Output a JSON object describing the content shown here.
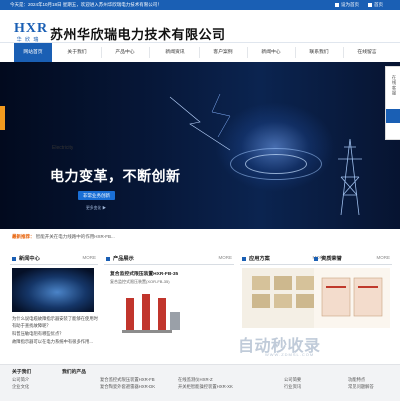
{
  "topbar": {
    "today": "今天是：2024年10月18日 星期五，欢迎进入苏州华欣瑞电力技术有限公司！",
    "favorite": "设为首页",
    "home": "首页"
  },
  "header": {
    "logo_mark": "HXR",
    "logo_cn": "华 欣 瑞",
    "company_cn": "苏州华欣瑞电力技术有限公司",
    "company_en": "Suzhou Huaxinrui Power Technology Co., Ltd."
  },
  "nav": {
    "items": [
      "网站首页",
      "关于我们",
      "产品中心",
      "新闻资讯",
      "客户案例",
      "新闻中心",
      "联系我们",
      "在线留言"
    ]
  },
  "banner": {
    "title_en": "Electricity",
    "title_cn": "电力变革，不断创新",
    "button": "非常业务创新",
    "sub": "更多变化 ▶"
  },
  "rightbar": {
    "label": "在线客服"
  },
  "notice": {
    "label": "最新推荐：",
    "text": "智能开关在电力线路中的作用HXR-FB..."
  },
  "sections": {
    "news": {
      "title": "新闻中心",
      "more": "MORE",
      "items": [
        "为什么说电缆故障指示器安装了能够在使用时有助于查找故障呢？",
        "科普压敏电阻有哪些优点？",
        "故障指示器可以在电力系统中有很多作用..."
      ]
    },
    "products": {
      "title": "产品展示",
      "more": "MORE",
      "name": "复合监控式限压装置HXR-FB-35",
      "desc": "复合监控式限压装置(XOR-FB-35)"
    },
    "cases": {
      "title": "应用方案",
      "more": "MORE"
    },
    "honors": {
      "title": "资质荣誉",
      "more": "MORE"
    }
  },
  "footer": {
    "about": {
      "title": "关于我们",
      "items": [
        "公司简介",
        "企业文化"
      ]
    },
    "products": {
      "title": "我们的产品",
      "items": [
        "复合监控式限压装置HXR-FB",
        "复合陶瓷外套避雷器HXR-DK"
      ]
    },
    "col3": {
      "items": [
        "在线监测仪HXR-Z",
        "开关柜智能操控装置HXR-XK"
      ]
    },
    "col4": {
      "items": [
        "公司简要",
        "行业资讯"
      ]
    },
    "col5": {
      "items": [
        "功能特点",
        "常见问题解答"
      ]
    }
  },
  "watermark": {
    "main": "自动秒收录",
    "sub": "WWW.ZDMSL.COM"
  },
  "colors": {
    "brand_blue": "#1a5fb4",
    "accent_orange": "#f39b1f"
  }
}
